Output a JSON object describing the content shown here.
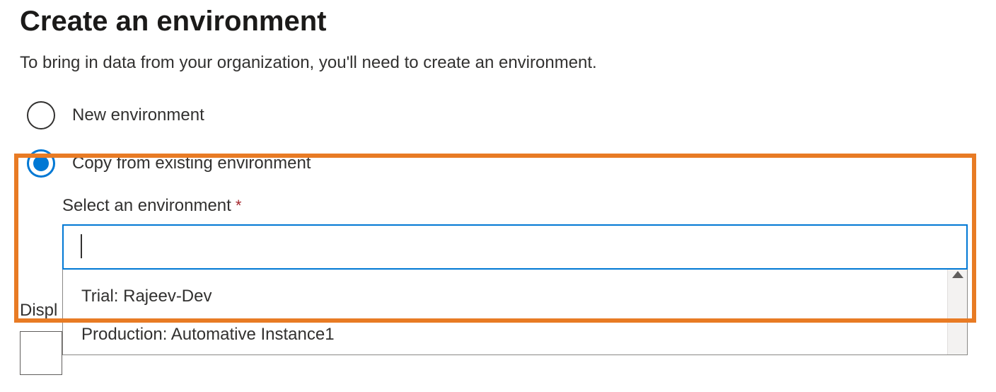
{
  "title": "Create an environment",
  "subtitle": "To bring in data from your organization, you'll need to create an environment.",
  "radios": {
    "new": {
      "label": "New environment",
      "selected": false
    },
    "copy": {
      "label": "Copy from existing environment",
      "selected": true
    }
  },
  "select": {
    "label": "Select an environment",
    "required_marker": "*",
    "value": "",
    "options": [
      "Trial: Rajeev-Dev",
      "Production: Automative Instance1"
    ]
  },
  "display_name_label_partial": "Displ"
}
